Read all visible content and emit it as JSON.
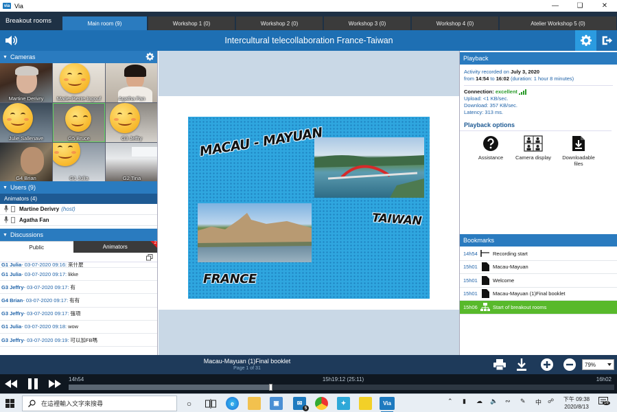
{
  "window": {
    "app_name": "Via",
    "logo_text": "via"
  },
  "tabs": {
    "breakout_label": "Breakout rooms",
    "rooms": [
      "Main room (9)",
      "Workshop 1 (0)",
      "Workshop 2 (0)",
      "Workshop 3 (0)",
      "Workshop 4 (0)",
      "Atelier Workshop 5 (0)"
    ],
    "active_index": 0
  },
  "header": {
    "session_title": "Intercultural telecollaboration France-Taiwan"
  },
  "cameras": {
    "title": "Cameras",
    "tiles": [
      {
        "name": "Martine Derivry",
        "emoji": false,
        "selected": false
      },
      {
        "name": "Marie-Pierre Ingouf",
        "emoji": true,
        "selected": false
      },
      {
        "name": "Agatha Fan",
        "emoji": false,
        "selected": false
      },
      {
        "name": "Julie Sallenave",
        "emoji": true,
        "selected": false
      },
      {
        "name": "G5 Bruce",
        "emoji": true,
        "selected": true
      },
      {
        "name": "G3 Jeffry",
        "emoji": true,
        "selected": false
      },
      {
        "name": "G4 Brian",
        "emoji": false,
        "selected": false
      },
      {
        "name": "G1 Julia",
        "emoji": true,
        "selected": false
      },
      {
        "name": "G2 Tina",
        "emoji": false,
        "selected": false
      }
    ]
  },
  "users": {
    "title": "Users (9)",
    "animators_title": "Animators (4)",
    "list": [
      {
        "name": "Martine Derivry",
        "role": "(host)"
      },
      {
        "name": "Agatha Fan",
        "role": ""
      }
    ]
  },
  "discussions": {
    "title": "Discussions",
    "tab_public": "Public",
    "tab_animators": "Animators",
    "animators_badge": "2",
    "messages": [
      {
        "author": "G1 Julia",
        "time": " - 03-07-2020 09:16:",
        "text": "來什麼"
      },
      {
        "author": "G1 Julia",
        "time": " - 03-07-2020 09:17:",
        "text": "likke"
      },
      {
        "author": "G3 Jeffry",
        "time": " - 03-07-2020 09:17:",
        "text": "有"
      },
      {
        "author": "G4 Brian",
        "time": " - 03-07-2020 09:17:",
        "text": "有有"
      },
      {
        "author": "G3 Jeffry",
        "time": " - 03-07-2020 09:17:",
        "text": "強項"
      },
      {
        "author": "G1 Julia",
        "time": " - 03-07-2020 09:18:",
        "text": "wow"
      },
      {
        "author": "G3 Jeffry",
        "time": " - 03-07-2020 09:19:",
        "text": "可以加FB嗎"
      }
    ]
  },
  "slide": {
    "title_main": "MACAU - MAYUAN",
    "label_taiwan": "TAIWAN",
    "label_france": "FRANCE",
    "colors": {
      "background": "#2fa6df"
    }
  },
  "playback": {
    "title": "Playback",
    "recorded_prefix": "Activity recorded on ",
    "recorded_date": "July 3, 2020",
    "from_prefix": "from ",
    "start_time": "14:54",
    "to_word": " to ",
    "end_time": "16:02",
    "duration": " (duration: 1 hour 8 minutes)",
    "connection_label": "Connection: ",
    "connection_value": "excellent",
    "upload": "Upload: <1 KB/sec.",
    "download": "Download: 357 KB/sec.",
    "latency": "Latency: 313 ms.",
    "options_title": "Playback options",
    "options": [
      {
        "label": "Assistance",
        "icon": "help-icon"
      },
      {
        "label": "Camera display",
        "icon": "camera-grid-icon"
      },
      {
        "label": "Downloadable files",
        "icon": "download-file-icon"
      }
    ]
  },
  "bookmarks": {
    "title": "Bookmarks",
    "items": [
      {
        "time": "14h54",
        "label": "Recording start",
        "icon": "pin-icon",
        "active": false
      },
      {
        "time": "15h01",
        "label": "Macau-Mayuan",
        "icon": "document-icon",
        "active": false
      },
      {
        "time": "15h01",
        "label": "Welcome",
        "icon": "document-icon",
        "active": false
      },
      {
        "time": "15h01",
        "label": "Macau-Mayuan (1)Final booklet",
        "icon": "document-icon",
        "active": false
      },
      {
        "time": "15h06",
        "label": "Start of breakout rooms",
        "icon": "breakout-icon",
        "active": true
      }
    ]
  },
  "document": {
    "title": "Macau-Mayuan (1)Final booklet",
    "page": "Page 1 of 31",
    "zoom": "79%"
  },
  "player": {
    "time_start": "14h54",
    "time_current": "15h19:12 (25:11)",
    "time_end": "16h02",
    "progress": 0.37
  },
  "taskbar": {
    "search_placeholder": "在這裡輸入文字來搜尋",
    "clock_time": "下午 09:38",
    "clock_date": "2020/8/13",
    "tray_lang": "中",
    "notifications": "16",
    "mail_badge": "5"
  }
}
